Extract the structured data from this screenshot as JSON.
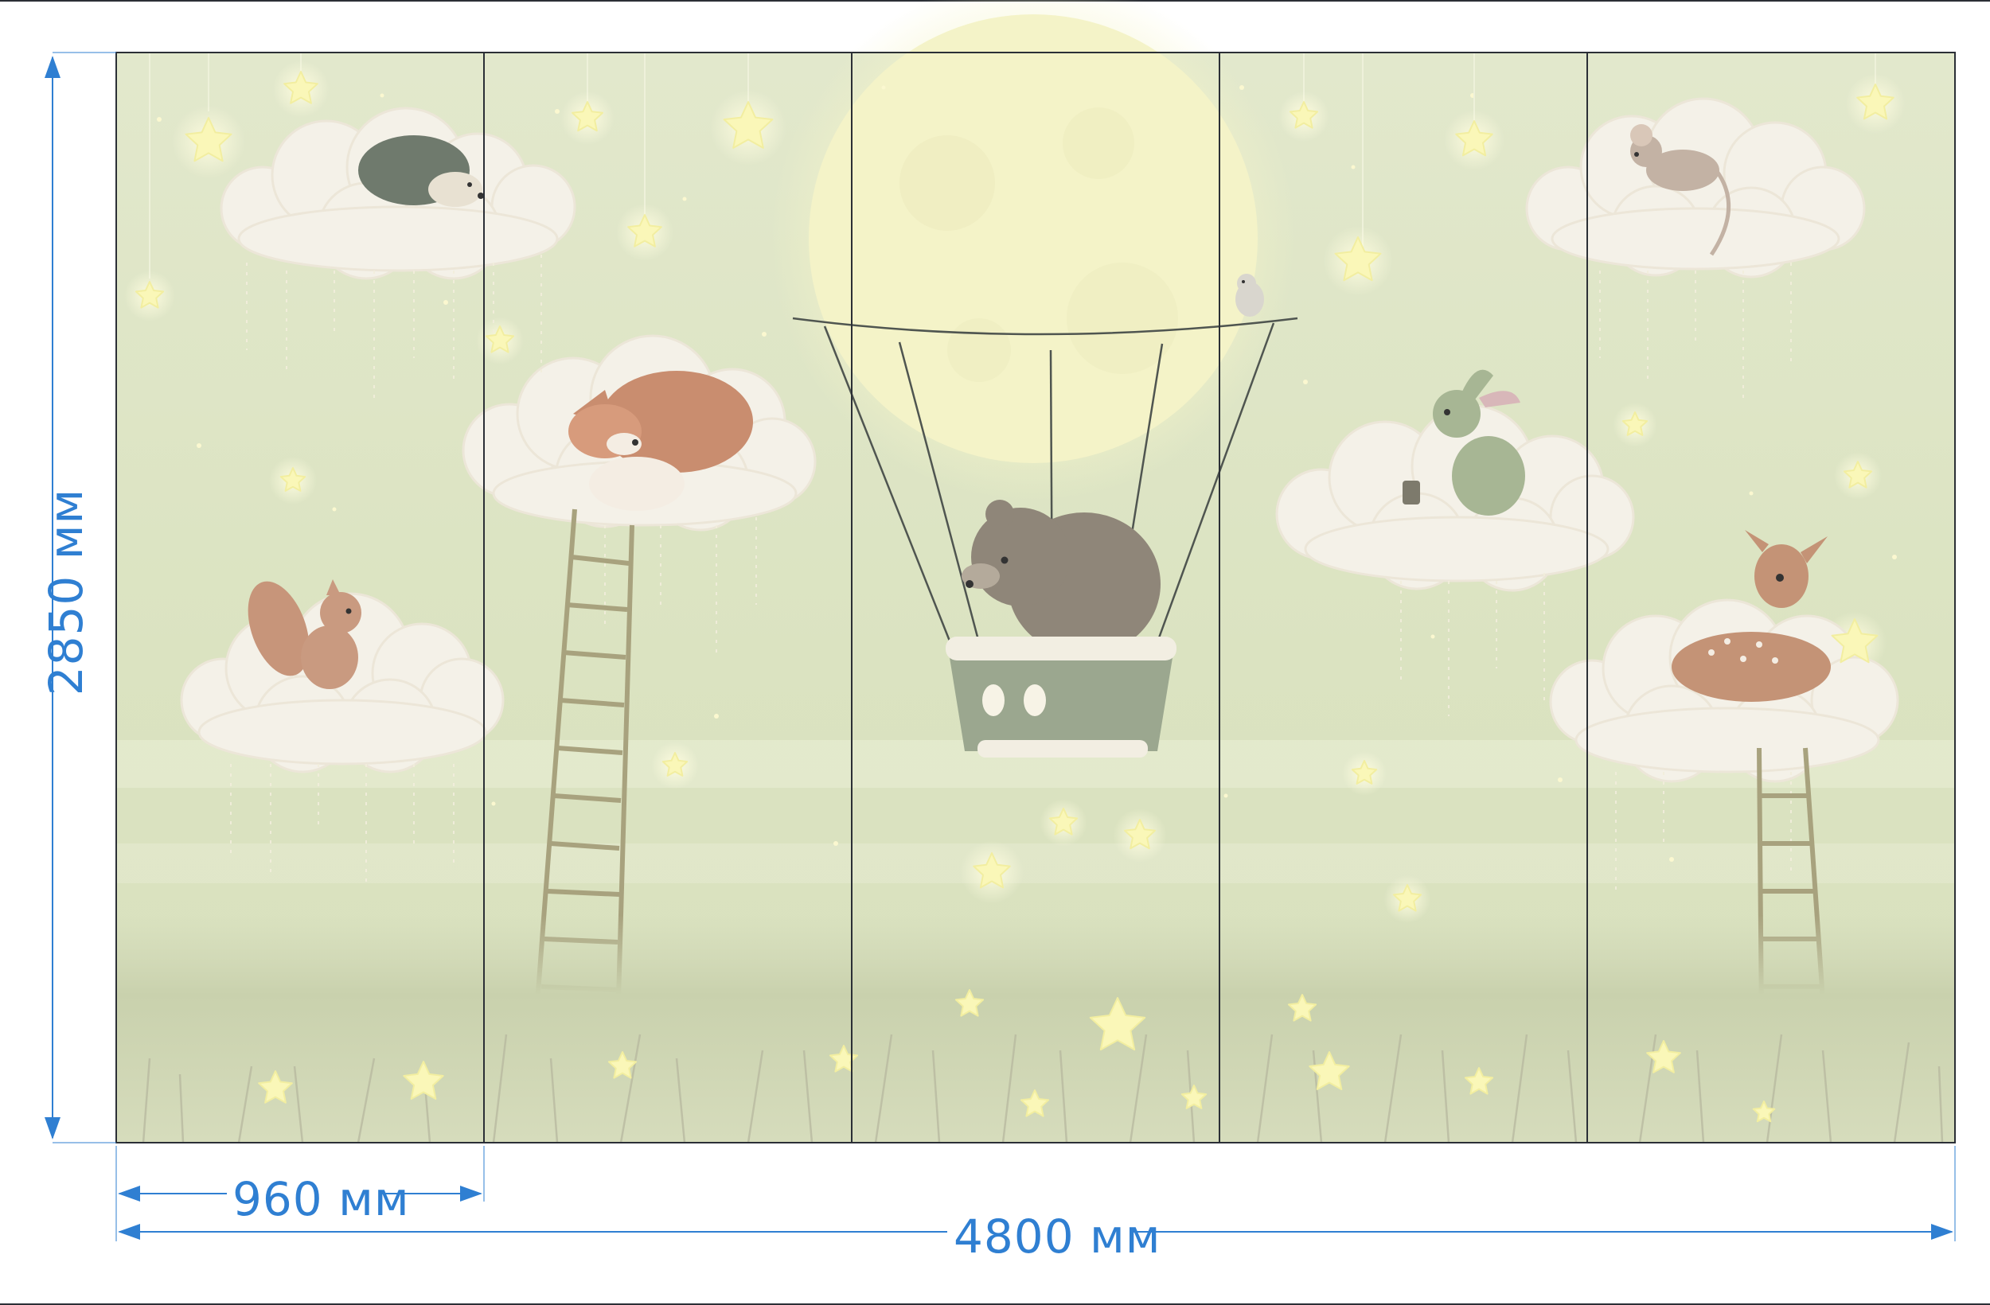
{
  "dimensions": {
    "panel_width": "960 мм",
    "total_width": "4800 мм",
    "height": "2850 мм"
  },
  "mural": {
    "panel_count": 5,
    "colors": {
      "background": "#dfe6c6",
      "moon": "#f6f5c9",
      "cloud": "#f4f1e8",
      "star": "#fbf6a6",
      "grass": "#c5cda9",
      "ladder": "#a8a27e",
      "dimension": "#2f7fd2",
      "panel_divider": "#2b2f36"
    },
    "animals": [
      "hedgehog",
      "fox",
      "squirrel",
      "bear",
      "bird",
      "rabbit",
      "mouse",
      "deer"
    ]
  }
}
